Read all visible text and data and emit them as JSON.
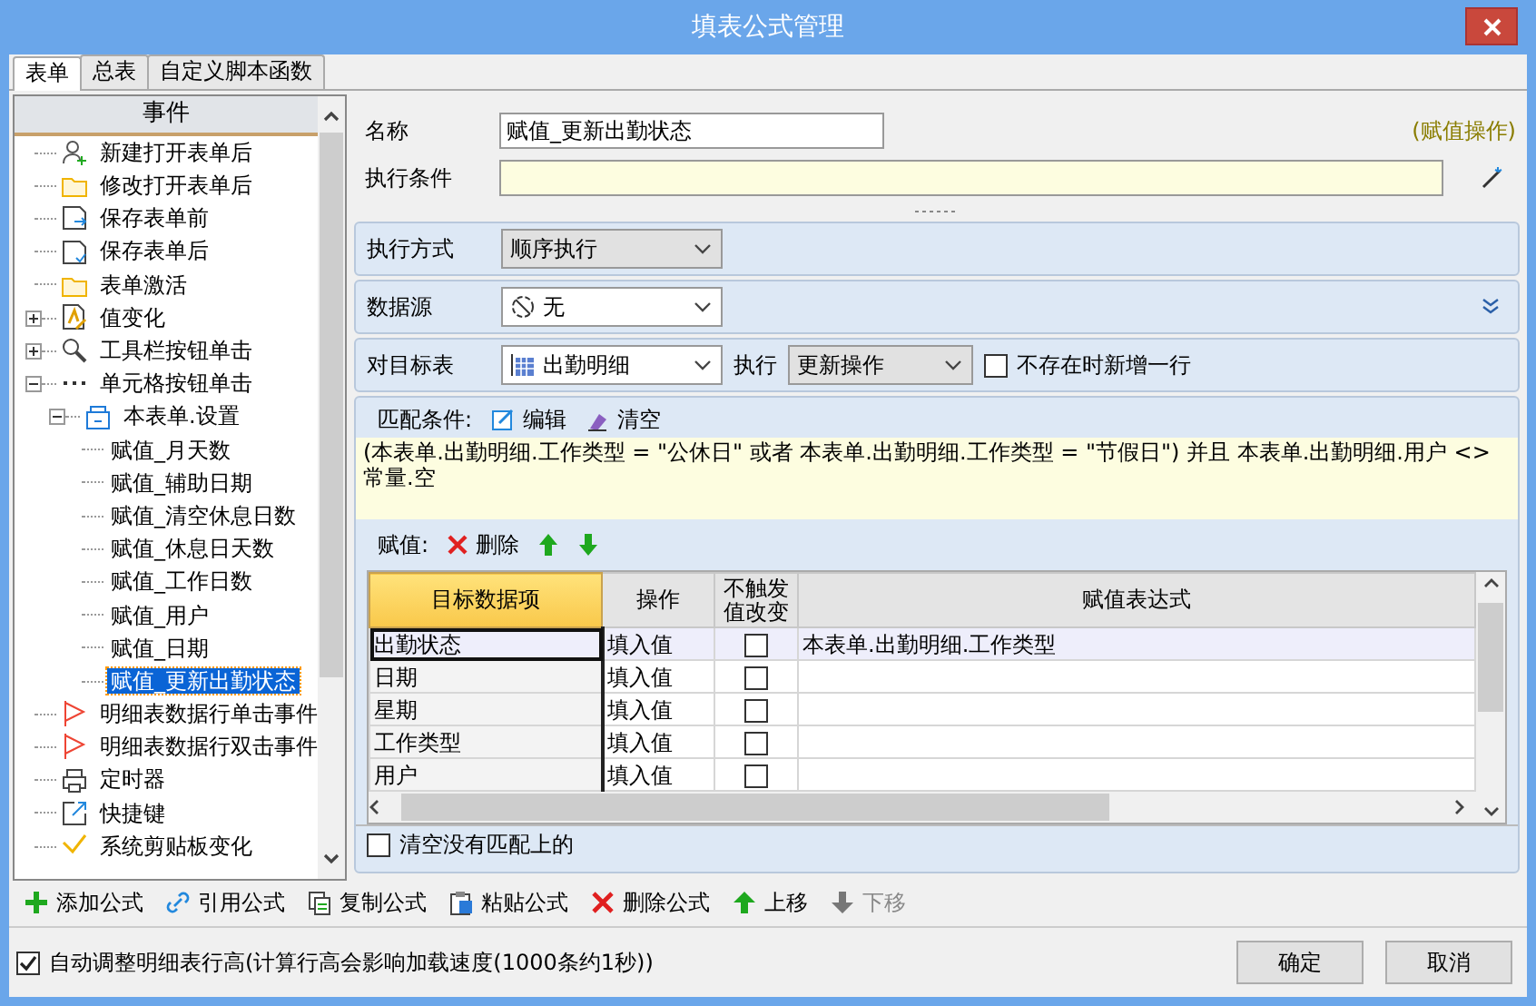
{
  "window": {
    "title": "填表公式管理"
  },
  "tabs": [
    {
      "label": "表单",
      "selected": true
    },
    {
      "label": "总表",
      "selected": false
    },
    {
      "label": "自定义脚本函数",
      "selected": false
    }
  ],
  "tree": {
    "header": "事件",
    "items": [
      {
        "label": "新建打开表单后",
        "kind": "user",
        "selected": false
      },
      {
        "label": "修改打开表单后",
        "kind": "folder",
        "selected": false
      },
      {
        "label": "保存表单前",
        "kind": "save-arrow",
        "selected": false
      },
      {
        "label": "保存表单后",
        "kind": "save-check",
        "selected": false
      },
      {
        "label": "表单激活",
        "kind": "folder",
        "selected": false
      },
      {
        "label": "值变化",
        "kind": "edit",
        "selected": false,
        "expanded": false
      },
      {
        "label": "工具栏按钮单击",
        "kind": "tool",
        "selected": false,
        "expanded": false
      },
      {
        "label": "单元格按钮单击",
        "kind": "dots",
        "selected": false,
        "expanded": true,
        "children": [
          {
            "label": "本表单.设置",
            "kind": "form",
            "selected": false,
            "expanded": true,
            "children": [
              {
                "label": "赋值_月天数",
                "selected": false
              },
              {
                "label": "赋值_辅助日期",
                "selected": false
              },
              {
                "label": "赋值_清空休息日数",
                "selected": false
              },
              {
                "label": "赋值_休息日天数",
                "selected": false
              },
              {
                "label": "赋值_工作日数",
                "selected": false
              },
              {
                "label": "赋值_用户",
                "selected": false
              },
              {
                "label": "赋值_日期",
                "selected": false
              },
              {
                "label": "赋值_更新出勤状态",
                "selected": true
              }
            ]
          }
        ]
      },
      {
        "label": "明细表数据行单击事件",
        "kind": "flag",
        "selected": false
      },
      {
        "label": "明细表数据行双击事件",
        "kind": "flag",
        "selected": false
      },
      {
        "label": "定时器",
        "kind": "printer",
        "selected": false
      },
      {
        "label": "快捷键",
        "kind": "shortcut",
        "selected": false
      },
      {
        "label": "系统剪贴板变化",
        "kind": "clipboard",
        "selected": false
      }
    ]
  },
  "form": {
    "name": {
      "label": "名称",
      "value": "赋值_更新出勤状态"
    },
    "operation_tag": "(赋值操作)",
    "condition": {
      "label": "执行条件"
    },
    "exec_mode": {
      "label": "执行方式",
      "value": "顺序执行"
    },
    "datasource": {
      "label": "数据源",
      "value": "无"
    },
    "target": {
      "label": "对目标表",
      "value": "出勤明细",
      "exec_label": "执行",
      "exec_value": "更新操作",
      "add_row": {
        "label": "不存在时新增一行",
        "checked": false
      }
    },
    "match": {
      "label": "匹配条件:",
      "edit": "编辑",
      "clear": "清空",
      "expression": "(本表单.出勤明细.工作类型 = \"公休日\" 或者 本表单.出勤明细.工作类型 = \"节假日\") 并且 本表单.出勤明细.用户 <> 常量.空"
    },
    "assign": {
      "label": "赋值:",
      "delete": "删除"
    },
    "grid": {
      "columns": [
        {
          "label": "目标数据项",
          "selected": true
        },
        {
          "label": "操作",
          "selected": false
        },
        {
          "label": "不触发值改变",
          "selected": false
        },
        {
          "label": "赋值表达式",
          "selected": false
        }
      ],
      "rows": [
        {
          "target": "出勤状态",
          "op": "填入值",
          "no_trigger": false,
          "expr": "本表单.出勤明细.工作类型",
          "selected": true
        },
        {
          "target": "日期",
          "op": "填入值",
          "no_trigger": false,
          "selected": false
        },
        {
          "target": "星期",
          "op": "填入值",
          "no_trigger": false,
          "selected": false
        },
        {
          "target": "工作类型",
          "op": "填入值",
          "no_trigger": false,
          "selected": false
        },
        {
          "target": "用户",
          "op": "填入值",
          "no_trigger": false,
          "selected": false
        }
      ]
    },
    "clear_unmatched": {
      "label": "清空没有匹配上的",
      "checked": false
    }
  },
  "toolbar": [
    {
      "label": "添加公式",
      "kind": "add",
      "disabled": false
    },
    {
      "label": "引用公式",
      "kind": "link",
      "disabled": false
    },
    {
      "label": "复制公式",
      "kind": "copy",
      "disabled": false
    },
    {
      "label": "粘贴公式",
      "kind": "paste",
      "disabled": false
    },
    {
      "label": "删除公式",
      "kind": "delete",
      "disabled": false
    },
    {
      "label": "上移",
      "kind": "up",
      "disabled": false
    },
    {
      "label": "下移",
      "kind": "down",
      "disabled": true
    }
  ],
  "footer": {
    "auto_height": {
      "label": "自动调整明细表行高(计算行高会影响加载速度(1000条约1秒))",
      "checked": true
    },
    "buttons": [
      "确定",
      "取消"
    ]
  }
}
